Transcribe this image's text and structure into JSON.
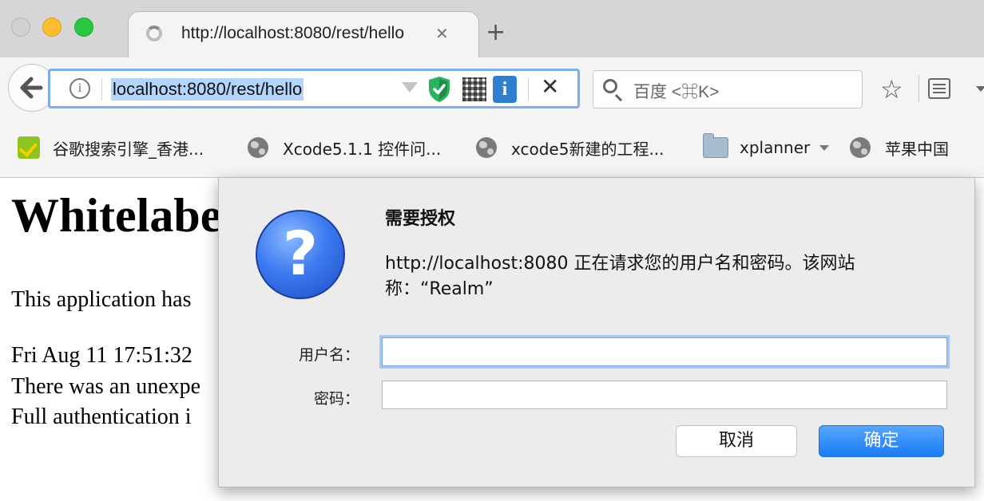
{
  "tab": {
    "title": "http://localhost:8080/rest/hello",
    "close_glyph": "✕",
    "new_tab_glyph": "+"
  },
  "navbar": {
    "back_glyph": "←",
    "info_glyph": "i",
    "url": "localhost:8080/rest/hello",
    "badge_glyph": "i",
    "stop_glyph": "✕",
    "search_placeholder": "百度 <⌘K>",
    "star_glyph": "☆"
  },
  "bookmarks": [
    {
      "label": "谷歌搜索引擎_香港...",
      "icon": "google-hk-favicon"
    },
    {
      "label": "Xcode5.1.1 控件问...",
      "icon": "globe-icon"
    },
    {
      "label": "xcode5新建的工程...",
      "icon": "globe-icon"
    },
    {
      "label": "xplanner",
      "icon": "folder-icon"
    },
    {
      "label": "苹果中国",
      "icon": "globe-icon"
    }
  ],
  "page": {
    "heading": "Whitelabe",
    "lines": [
      "This application has",
      "Fri Aug 11 17:51:32",
      "There was an unexpe",
      "Full authentication i"
    ]
  },
  "dialog": {
    "icon_glyph": "?",
    "title": "需要授权",
    "message": "http://localhost:8080 正在请求您的用户名和密码。该网站称：“Realm”",
    "username_label": "用户名：",
    "password_label": "密码：",
    "username_value": "",
    "password_value": "",
    "cancel_label": "取消",
    "ok_label": "确定"
  },
  "colors": {
    "accent": "#1a7cf5",
    "url_selection": "#b3d4fc",
    "focus_ring": "#79aef1"
  }
}
